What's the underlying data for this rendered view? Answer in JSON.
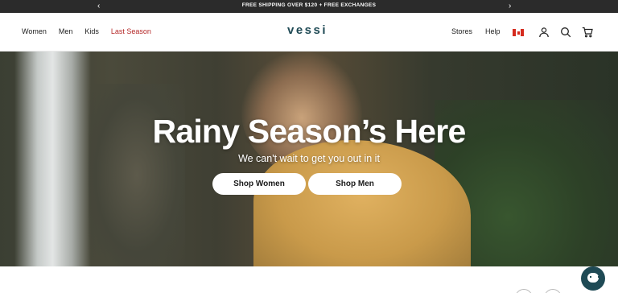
{
  "announcement": {
    "message": "FREE SHIPPING OVER $120 + FREE EXCHANGES",
    "prev_arrow": "‹",
    "next_arrow": "›"
  },
  "header": {
    "logo": "vessi",
    "nav_left": [
      "Women",
      "Men",
      "Kids",
      "Last Season"
    ],
    "nav_right": [
      "Stores",
      "Help"
    ],
    "icons": [
      "canada-flag-icon",
      "account-icon",
      "search-icon",
      "cart-icon"
    ]
  },
  "hero": {
    "title": "Rainy Season’s Here",
    "subtitle": "We can't wait to get you out in it",
    "buttons": {
      "women": "Shop Women",
      "men": "Shop Men"
    }
  },
  "colors": {
    "announcement_bg": "#2b2b2b",
    "logo": "#1f4a55",
    "last_season": "#b52a2a",
    "chat_button": "#1f4a55"
  }
}
